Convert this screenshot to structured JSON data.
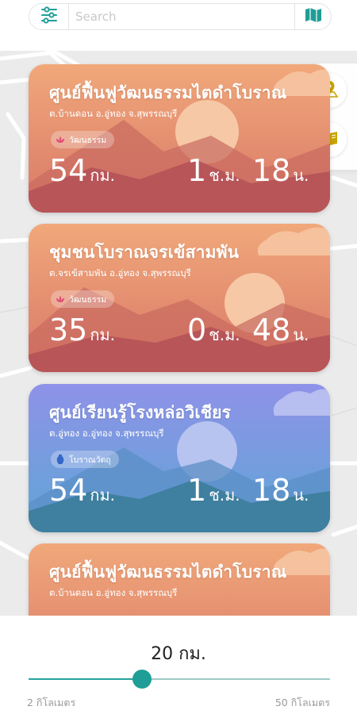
{
  "search": {
    "placeholder": "Search",
    "filter_icon": "sliders-icon",
    "map_icon": "map-icon"
  },
  "side_panel": {
    "buttons": [
      "map-pin-icon",
      "book-icon"
    ]
  },
  "cards": [
    {
      "title": "ศูนย์ฟื้นฟูวัฒนธรรมไตดำโบราณ",
      "subtitle": "ต.บ้านดอน อ.อู่ทอง จ.สุพรรณบุรี",
      "badge": "วัฒนธรรม",
      "distance": "54",
      "distance_unit": "กม.",
      "hours": "1",
      "hours_unit": "ช.ม.",
      "minutes": "18",
      "minutes_unit": "น.",
      "theme": "warm",
      "colors": {
        "top": "#f0a57a",
        "bottom": "#b84f57"
      }
    },
    {
      "title": "ชุมชนโบราณจรเข้สามพัน",
      "subtitle": "ต.จรเข้สามพัน อ.อู่ทอง จ.สุพรรณบุรี",
      "badge": "วัฒนธรรม",
      "distance": "35",
      "distance_unit": "กม.",
      "hours": "0",
      "hours_unit": "ช.ม.",
      "minutes": "48",
      "minutes_unit": "น.",
      "theme": "warm",
      "colors": {
        "top": "#f0a57a",
        "bottom": "#b84f57"
      }
    },
    {
      "title": "ศูนย์เรียนรู้โรงหล่อวิเชียร",
      "subtitle": "ต.อู่ทอง อ.อู่ทอง จ.สุพรรณบุรี",
      "badge": "โบราณวัตถุ",
      "distance": "54",
      "distance_unit": "กม.",
      "hours": "1",
      "hours_unit": "ช.ม.",
      "minutes": "18",
      "minutes_unit": "น.",
      "theme": "cool",
      "colors": {
        "top": "#8a92e6",
        "bottom": "#3f7f9f"
      }
    },
    {
      "title": "ศูนย์ฟื้นฟูวัฒนธรรมไตดำโบราณ",
      "subtitle": "ต.บ้านดอน อ.อู่ทอง จ.สุพรรณบุรี",
      "badge": "",
      "distance": "",
      "distance_unit": "",
      "hours": "",
      "hours_unit": "",
      "minutes": "",
      "minutes_unit": "",
      "theme": "warm",
      "colors": {
        "top": "#f0a57a",
        "bottom": "#b84f57"
      }
    }
  ],
  "slider": {
    "value_label": "20 กม.",
    "min_label": "2 กิโลเมตร",
    "max_label": "50 กิโลเมตร",
    "min": 2,
    "max": 50,
    "value": 20,
    "accent": "#1f9e97"
  }
}
